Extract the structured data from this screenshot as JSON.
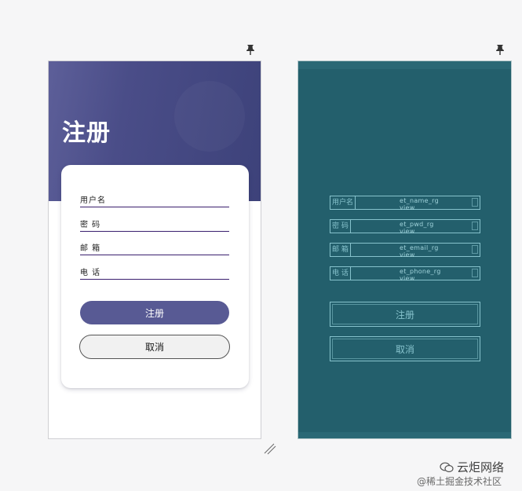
{
  "design_preview": {
    "title": "注册",
    "fields": [
      {
        "label": "用户名"
      },
      {
        "label": "密 码"
      },
      {
        "label": "邮 箱"
      },
      {
        "label": "电 话"
      }
    ],
    "register_button": "注册",
    "cancel_button": "取消"
  },
  "blueprint_preview": {
    "rows": [
      {
        "label": "用户名",
        "id_line1": "et_name_rg",
        "id_line2": "view"
      },
      {
        "label": "密 码",
        "id_line1": "et_pwd_rg",
        "id_line2": "view"
      },
      {
        "label": "邮 箱",
        "id_line1": "et_email_rg",
        "id_line2": "view"
      },
      {
        "label": "电 话",
        "id_line1": "et_phone_rg",
        "id_line2": "view"
      }
    ],
    "register_button": "注册",
    "cancel_button": "取消"
  },
  "watermark": {
    "brand": "云炬网络",
    "sub": "@稀土掘金技术社区"
  },
  "colors": {
    "header_gradient_start": "#5d5f99",
    "header_gradient_end": "#3d427a",
    "primary_button": "#585a94",
    "field_underline": "#3a1f6e",
    "blueprint_bg": "#235f6c",
    "blueprint_line": "#86c2cc"
  },
  "icons": {
    "pin": "pin-icon",
    "resize": "resize-handle-icon",
    "brand": "wechat-logo-icon"
  }
}
